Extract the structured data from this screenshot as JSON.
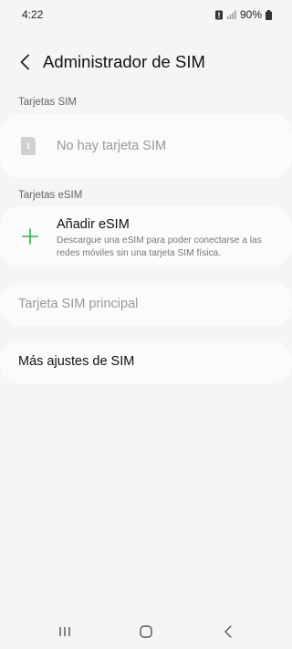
{
  "status_bar": {
    "time": "4:22",
    "battery": "90%"
  },
  "header": {
    "title": "Administrador de SIM"
  },
  "sections": {
    "sim_label": "Tarjetas SIM",
    "esim_label": "Tarjetas eSIM"
  },
  "sim_card": {
    "slot_number": "1",
    "text": "No hay tarjeta SIM"
  },
  "esim": {
    "add_title": "Añadir eSIM",
    "add_description": "Descargue una eSIM para poder conectarse a las redes móviles sin una tarjeta SIM física."
  },
  "primary_sim": {
    "label": "Tarjeta SIM principal"
  },
  "more_settings": {
    "label": "Más ajustes de SIM"
  },
  "colors": {
    "accent_green": "#2bb34a",
    "background": "#f5f5f5",
    "card": "#fbfbfb"
  }
}
